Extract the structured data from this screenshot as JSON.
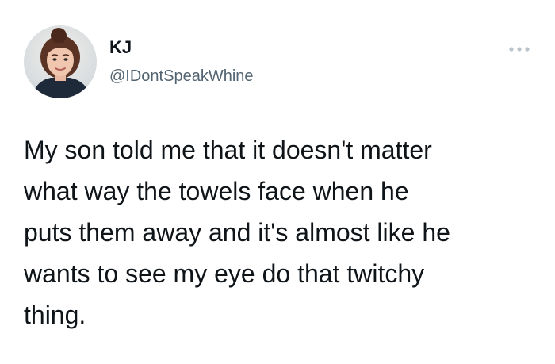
{
  "tweet": {
    "author": {
      "display_name": "KJ",
      "handle": "@IDontSpeakWhine"
    },
    "text": "My son told me that it doesn't matter\nwhat way the towels face when he\nputs them away and it's almost like he\nwants to see my eye do that twitchy\nthing.",
    "more_icon": "more-horizontal-icon",
    "avatar_icon": "profile-photo"
  },
  "colors": {
    "text_primary": "#0f1419",
    "text_secondary": "#536471",
    "more_icon": "#b9c3cc",
    "background": "#ffffff"
  }
}
